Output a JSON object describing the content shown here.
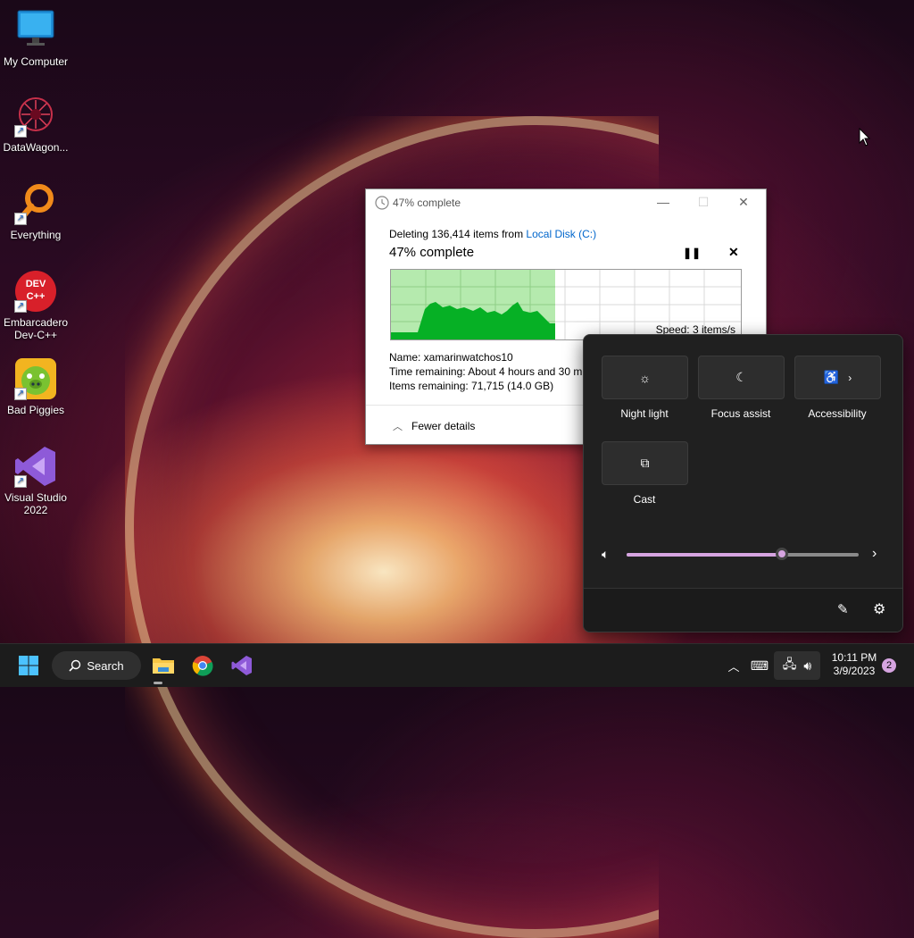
{
  "desktop": {
    "icons": [
      {
        "label": "My Computer",
        "icon": "monitor-icon"
      },
      {
        "label": "DataWagon...",
        "icon": "datawagon-icon"
      },
      {
        "label": "Everything",
        "icon": "magnifier-icon"
      },
      {
        "label": "Embarcadero Dev-C++",
        "icon": "devcpp-icon",
        "badge": "DEV C++"
      },
      {
        "label": "Bad Piggies",
        "icon": "bad-piggies-icon"
      },
      {
        "label": "Visual Studio 2022",
        "icon": "visual-studio-icon"
      }
    ]
  },
  "dialog": {
    "title": "47% complete",
    "deleting_prefix": "Deleting 136,414 items from ",
    "location_link": "Local Disk (C:)",
    "progress_heading": "47% complete",
    "progress": 0.47,
    "speed": "Speed: 3 items/s",
    "name_row": "Name:  xamarinwatchos10",
    "time_row": "Time remaining:  About 4 hours and 30 m",
    "items_row": "Items remaining:  71,715 (14.0 GB)",
    "fewer_details": "Fewer details"
  },
  "quick_settings": {
    "tiles": [
      {
        "label": "Night light",
        "icon": "brightness-icon"
      },
      {
        "label": "Focus assist",
        "icon": "moon-icon"
      },
      {
        "label": "Accessibility",
        "icon": "accessibility-icon"
      },
      {
        "label": "Cast",
        "icon": "cast-icon"
      }
    ],
    "volume_level": 0.67
  },
  "taskbar": {
    "search_label": "Search",
    "time": "10:11 PM",
    "date": "3/9/2023",
    "notification_count": "2"
  },
  "colors": {
    "progress_green": "#06b025",
    "progress_fill_bg": "#a8e6a0",
    "accent_pink": "#d6a4e0",
    "link_blue": "#0066cc"
  }
}
